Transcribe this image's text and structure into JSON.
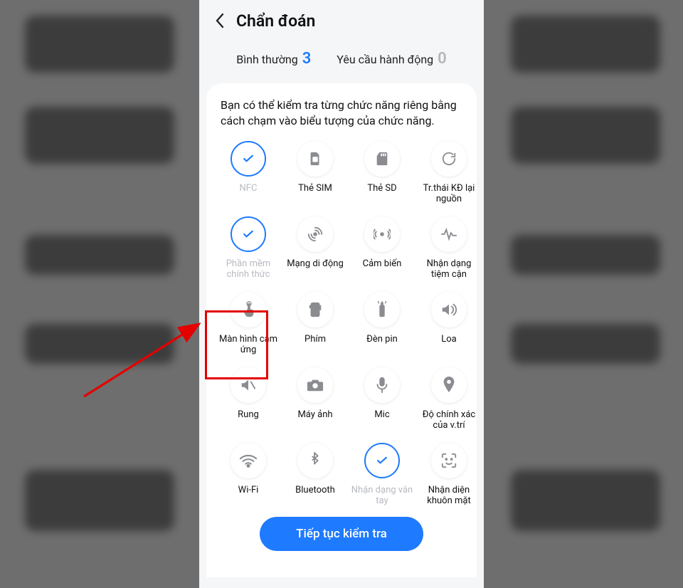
{
  "header": {
    "title": "Chẩn đoán"
  },
  "stats": {
    "normal_label": "Bình thường",
    "normal_count": "3",
    "action_label": "Yêu cầu hành động",
    "action_count": "0"
  },
  "description": "Bạn có thể kiểm tra từng chức năng riêng bằng cách chạm vào biểu tượng của chức năng.",
  "tiles": [
    {
      "id": "nfc",
      "label": "NFC",
      "checked": true,
      "dim": true
    },
    {
      "id": "sim",
      "label": "Thẻ SIM",
      "checked": false,
      "dim": false
    },
    {
      "id": "sd",
      "label": "Thẻ SD",
      "checked": false,
      "dim": false
    },
    {
      "id": "restart",
      "label": "Tr.thái KĐ lại nguồn",
      "checked": false,
      "dim": false
    },
    {
      "id": "official",
      "label": "Phần mềm chính thức",
      "checked": true,
      "dim": true
    },
    {
      "id": "mobile",
      "label": "Mạng di động",
      "checked": false,
      "dim": false
    },
    {
      "id": "sensor",
      "label": "Cảm biến",
      "checked": false,
      "dim": false
    },
    {
      "id": "proximity",
      "label": "Nhận dạng tiệm cận",
      "checked": false,
      "dim": false
    },
    {
      "id": "touch",
      "label": "Màn hình cảm ứng",
      "checked": false,
      "dim": false
    },
    {
      "id": "buttons",
      "label": "Phím",
      "checked": false,
      "dim": false
    },
    {
      "id": "flash",
      "label": "Đèn pin",
      "checked": false,
      "dim": false
    },
    {
      "id": "speaker",
      "label": "Loa",
      "checked": false,
      "dim": false
    },
    {
      "id": "vibrate",
      "label": "Rung",
      "checked": false,
      "dim": false
    },
    {
      "id": "camera",
      "label": "Máy ảnh",
      "checked": false,
      "dim": false
    },
    {
      "id": "mic",
      "label": "Mic",
      "checked": false,
      "dim": false
    },
    {
      "id": "location",
      "label": "Độ chính xác của v.trí",
      "checked": false,
      "dim": false
    },
    {
      "id": "wifi",
      "label": "Wi-Fi",
      "checked": false,
      "dim": false
    },
    {
      "id": "bluetooth",
      "label": "Bluetooth",
      "checked": false,
      "dim": false
    },
    {
      "id": "finger",
      "label": "Nhận dạng vân tay",
      "checked": true,
      "dim": true
    },
    {
      "id": "face",
      "label": "Nhận diện khuôn mặt",
      "checked": false,
      "dim": false
    }
  ],
  "cta": "Tiếp tục kiểm tra"
}
